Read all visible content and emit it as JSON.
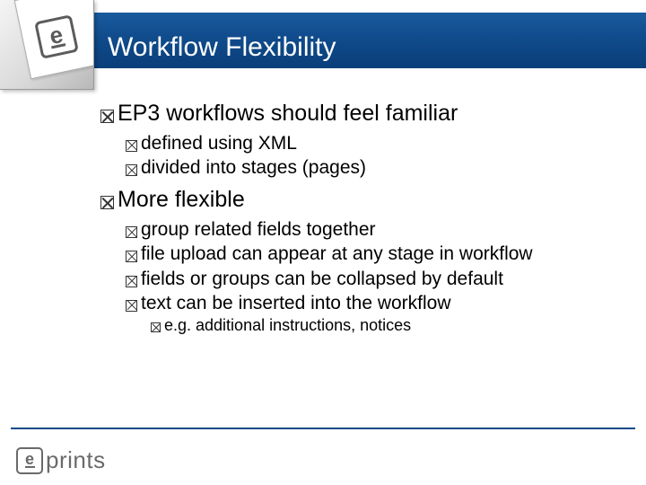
{
  "header": {
    "title": "Workflow Flexibility"
  },
  "bullets": [
    {
      "level": 1,
      "text": "EP3 workflows should feel familiar",
      "children": [
        {
          "level": 2,
          "text": "defined using XML"
        },
        {
          "level": 2,
          "text": "divided into stages (pages)"
        }
      ]
    },
    {
      "level": 1,
      "text": "More flexible",
      "children": [
        {
          "level": 2,
          "text": "group related fields together"
        },
        {
          "level": 2,
          "text": "file upload can appear at any stage in workflow"
        },
        {
          "level": 2,
          "text": "fields or groups can be collapsed by default"
        },
        {
          "level": 2,
          "text": "text can be inserted into the workflow",
          "children": [
            {
              "level": 3,
              "text": "e.g. additional instructions, notices"
            }
          ]
        }
      ]
    }
  ],
  "footer": {
    "logo_text": "prints",
    "badge_letter": "e"
  },
  "corner": {
    "badge_letter": "e"
  }
}
